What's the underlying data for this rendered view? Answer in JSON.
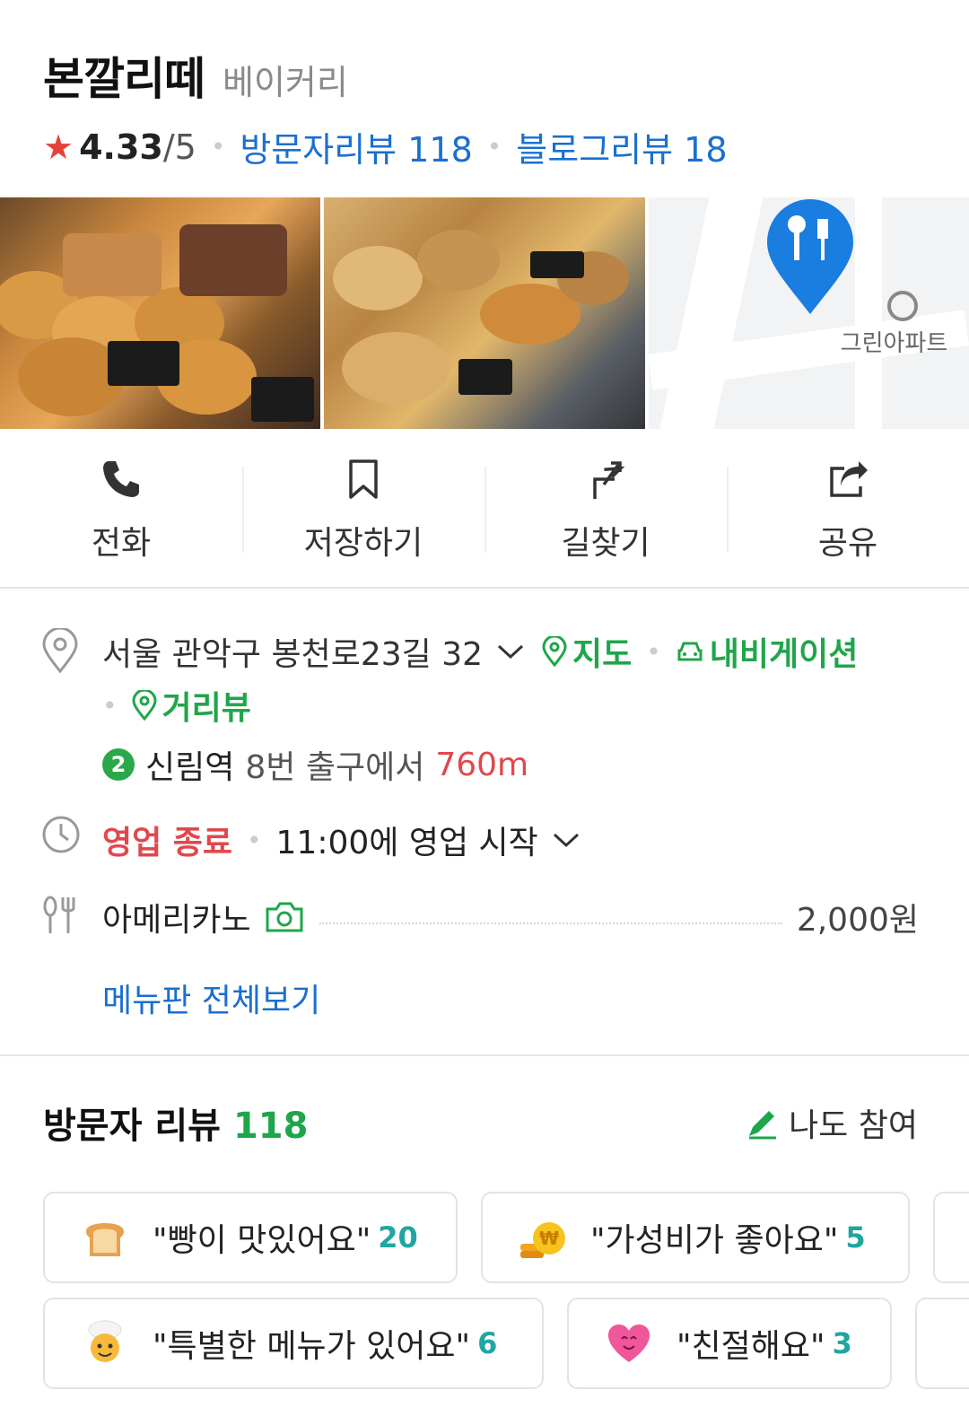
{
  "place": {
    "name": "본깔리떼",
    "category": "베이커리",
    "rating": "4.33",
    "rating_max": "/5",
    "visitor_reviews_link": "방문자리뷰 118",
    "blog_reviews_link": "블로그리뷰 18"
  },
  "photos": {
    "map_label": "그린아파트"
  },
  "actions": [
    {
      "label": "전화",
      "icon": "phone-icon"
    },
    {
      "label": "저장하기",
      "icon": "bookmark-icon"
    },
    {
      "label": "길찾기",
      "icon": "directions-icon"
    },
    {
      "label": "공유",
      "icon": "share-icon"
    }
  ],
  "info": {
    "address": "서울 관악구 봉천로23길 32",
    "map_link": "지도",
    "navigation_link": "내비게이션",
    "street_view_link": "거리뷰",
    "subway_line": "2",
    "subway_station": "신림역",
    "subway_exit": "8번 출구에서",
    "subway_distance": "760m",
    "status": "영업 종료",
    "next_open": "11:00에 영업 시작",
    "menu_item": "아메리카노",
    "menu_price": "2,000원",
    "menu_all": "메뉴판 전체보기"
  },
  "reviews": {
    "title": "방문자 리뷰",
    "count": "118",
    "join_label": "나도 참여",
    "chips_row1": [
      {
        "text": "\"빵이 맛있어요\"",
        "count": "20",
        "icon": "bread-icon"
      },
      {
        "text": "\"가성비가 좋아요\"",
        "count": "5",
        "icon": "coin-icon"
      }
    ],
    "chips_row2": [
      {
        "text": "\"특별한 메뉴가 있어요\"",
        "count": "6",
        "icon": "chef-icon"
      },
      {
        "text": "\"친절해요\"",
        "count": "3",
        "icon": "heart-icon"
      }
    ]
  },
  "colors": {
    "accent_blue": "#1a6fd0",
    "accent_green": "#1fa64a",
    "closed_red": "#e0484d",
    "star_red": "#e8403b"
  }
}
